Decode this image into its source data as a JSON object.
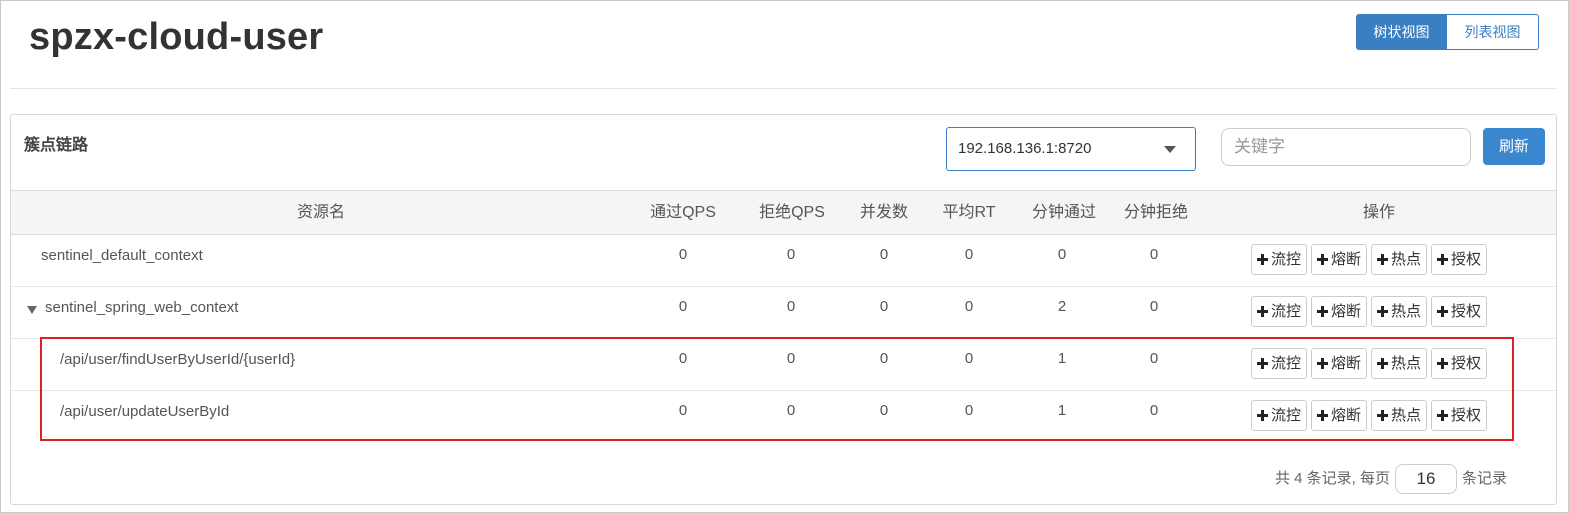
{
  "app": {
    "title": "spzx-cloud-user"
  },
  "view_toggle": {
    "tree_label": "树状视图",
    "list_label": "列表视图",
    "active": "tree"
  },
  "panel": {
    "heading": "簇点链路",
    "machine_select": "192.168.136.1:8720",
    "keyword_placeholder": "关键字",
    "refresh_label": "刷新"
  },
  "table": {
    "headers": [
      "资源名",
      "通过QPS",
      "拒绝QPS",
      "并发数",
      "平均RT",
      "分钟通过",
      "分钟拒绝",
      "操作"
    ],
    "rows": [
      {
        "name": "sentinel_default_context",
        "pass_qps": "0",
        "block_qps": "0",
        "threads": "0",
        "avg_rt": "0",
        "pass_min": "0",
        "block_min": "0"
      },
      {
        "name": "sentinel_spring_web_context",
        "pass_qps": "0",
        "block_qps": "0",
        "threads": "0",
        "avg_rt": "0",
        "pass_min": "2",
        "block_min": "0"
      },
      {
        "name": "/api/user/findUserByUserId/{userId}",
        "pass_qps": "0",
        "block_qps": "0",
        "threads": "0",
        "avg_rt": "0",
        "pass_min": "1",
        "block_min": "0"
      },
      {
        "name": "/api/user/updateUserById",
        "pass_qps": "0",
        "block_qps": "0",
        "threads": "0",
        "avg_rt": "0",
        "pass_min": "1",
        "block_min": "0"
      }
    ],
    "actions": {
      "flow": "流控",
      "degrade": "熔断",
      "hotspot": "热点",
      "authority": "授权"
    }
  },
  "pagination": {
    "count_text": "共 4 条记录, 每页",
    "page_size": "16",
    "suffix": "条记录"
  },
  "colors": {
    "primary": "#3a7fc1",
    "highlight": "#e02020"
  },
  "icons": {
    "expand_toggle": "caret-down-icon",
    "action_plus": "plus-icon"
  }
}
